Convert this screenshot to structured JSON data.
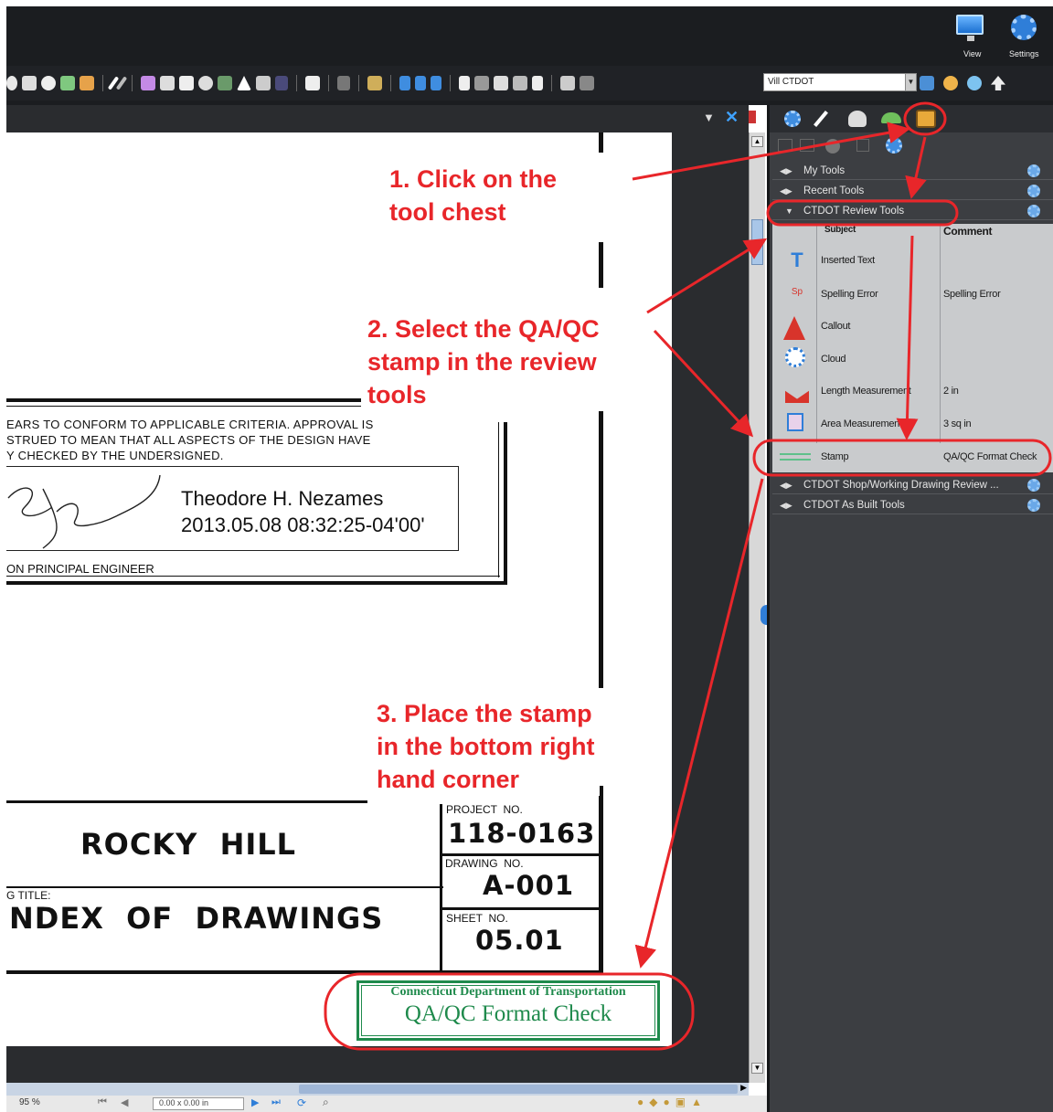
{
  "top": {
    "view_label": "View",
    "settings_label": "Settings",
    "profile_combo": "Vill CTDOT"
  },
  "annotations": {
    "step1": [
      "1. Click on the",
      "tool chest"
    ],
    "step2": [
      "2. Select the QA/QC",
      "stamp in the review",
      "tools"
    ],
    "step3": [
      "3. Place the stamp",
      "in the bottom right",
      "hand corner"
    ],
    "accent_color": "#e8262a"
  },
  "panel": {
    "sections": [
      {
        "label": "My Tools",
        "expanded": false
      },
      {
        "label": "Recent Tools",
        "expanded": false
      },
      {
        "label": "CTDOT Review Tools",
        "expanded": true
      },
      {
        "label": "CTDOT Shop/Working Drawing Review ...",
        "expanded": false
      },
      {
        "label": "CTDOT As Built Tools",
        "expanded": false
      }
    ],
    "columns": {
      "subject": "Subject",
      "comment": "Comment"
    },
    "tools": [
      {
        "icon": "inserted-text-icon",
        "subject": "Inserted Text",
        "comment": ""
      },
      {
        "icon": "spelling-error-icon",
        "subject": "Spelling Error",
        "comment": "Spelling Error"
      },
      {
        "icon": "callout-icon",
        "subject": "Callout",
        "comment": ""
      },
      {
        "icon": "cloud-icon",
        "subject": "Cloud",
        "comment": ""
      },
      {
        "icon": "length-measurement-icon",
        "subject": "Length Measurement",
        "comment": "2 in"
      },
      {
        "icon": "area-measurement-icon",
        "subject": "Area Measurement",
        "comment": "3 sq in"
      },
      {
        "icon": "stamp-icon",
        "subject": "Stamp",
        "comment": "QA/QC Format Check"
      }
    ]
  },
  "drawing": {
    "approval_lines": [
      "EARS TO CONFORM TO APPLICABLE CRITERIA. APPROVAL IS",
      "STRUED TO MEAN THAT ALL ASPECTS OF THE DESIGN HAVE",
      "Y CHECKED BY THE UNDERSIGNED."
    ],
    "signer_name": "Theodore H. Nezames",
    "signed_at": "2013.05.08 08:32:25-04'00'",
    "signer_title": "ON PRINCIPAL ENGINEER",
    "town": "ROCKY  HILL",
    "title_label": "G TITLE:",
    "title": "NDEX  OF  DRAWINGS",
    "project_no_label": "PROJECT  NO.",
    "project_no": "118-0163",
    "drawing_no_label": "DRAWING  NO.",
    "drawing_no": "A-001",
    "sheet_no_label": "SHEET  NO.",
    "sheet_no": "05.01"
  },
  "stamp": {
    "line1": "Connecticut Department of Transportation",
    "line2": "QA/QC Format Check",
    "color": "#1f8a4c"
  },
  "statusbar": {
    "zoom": "95 %",
    "page_size": "0.00 x 0.00 in"
  }
}
